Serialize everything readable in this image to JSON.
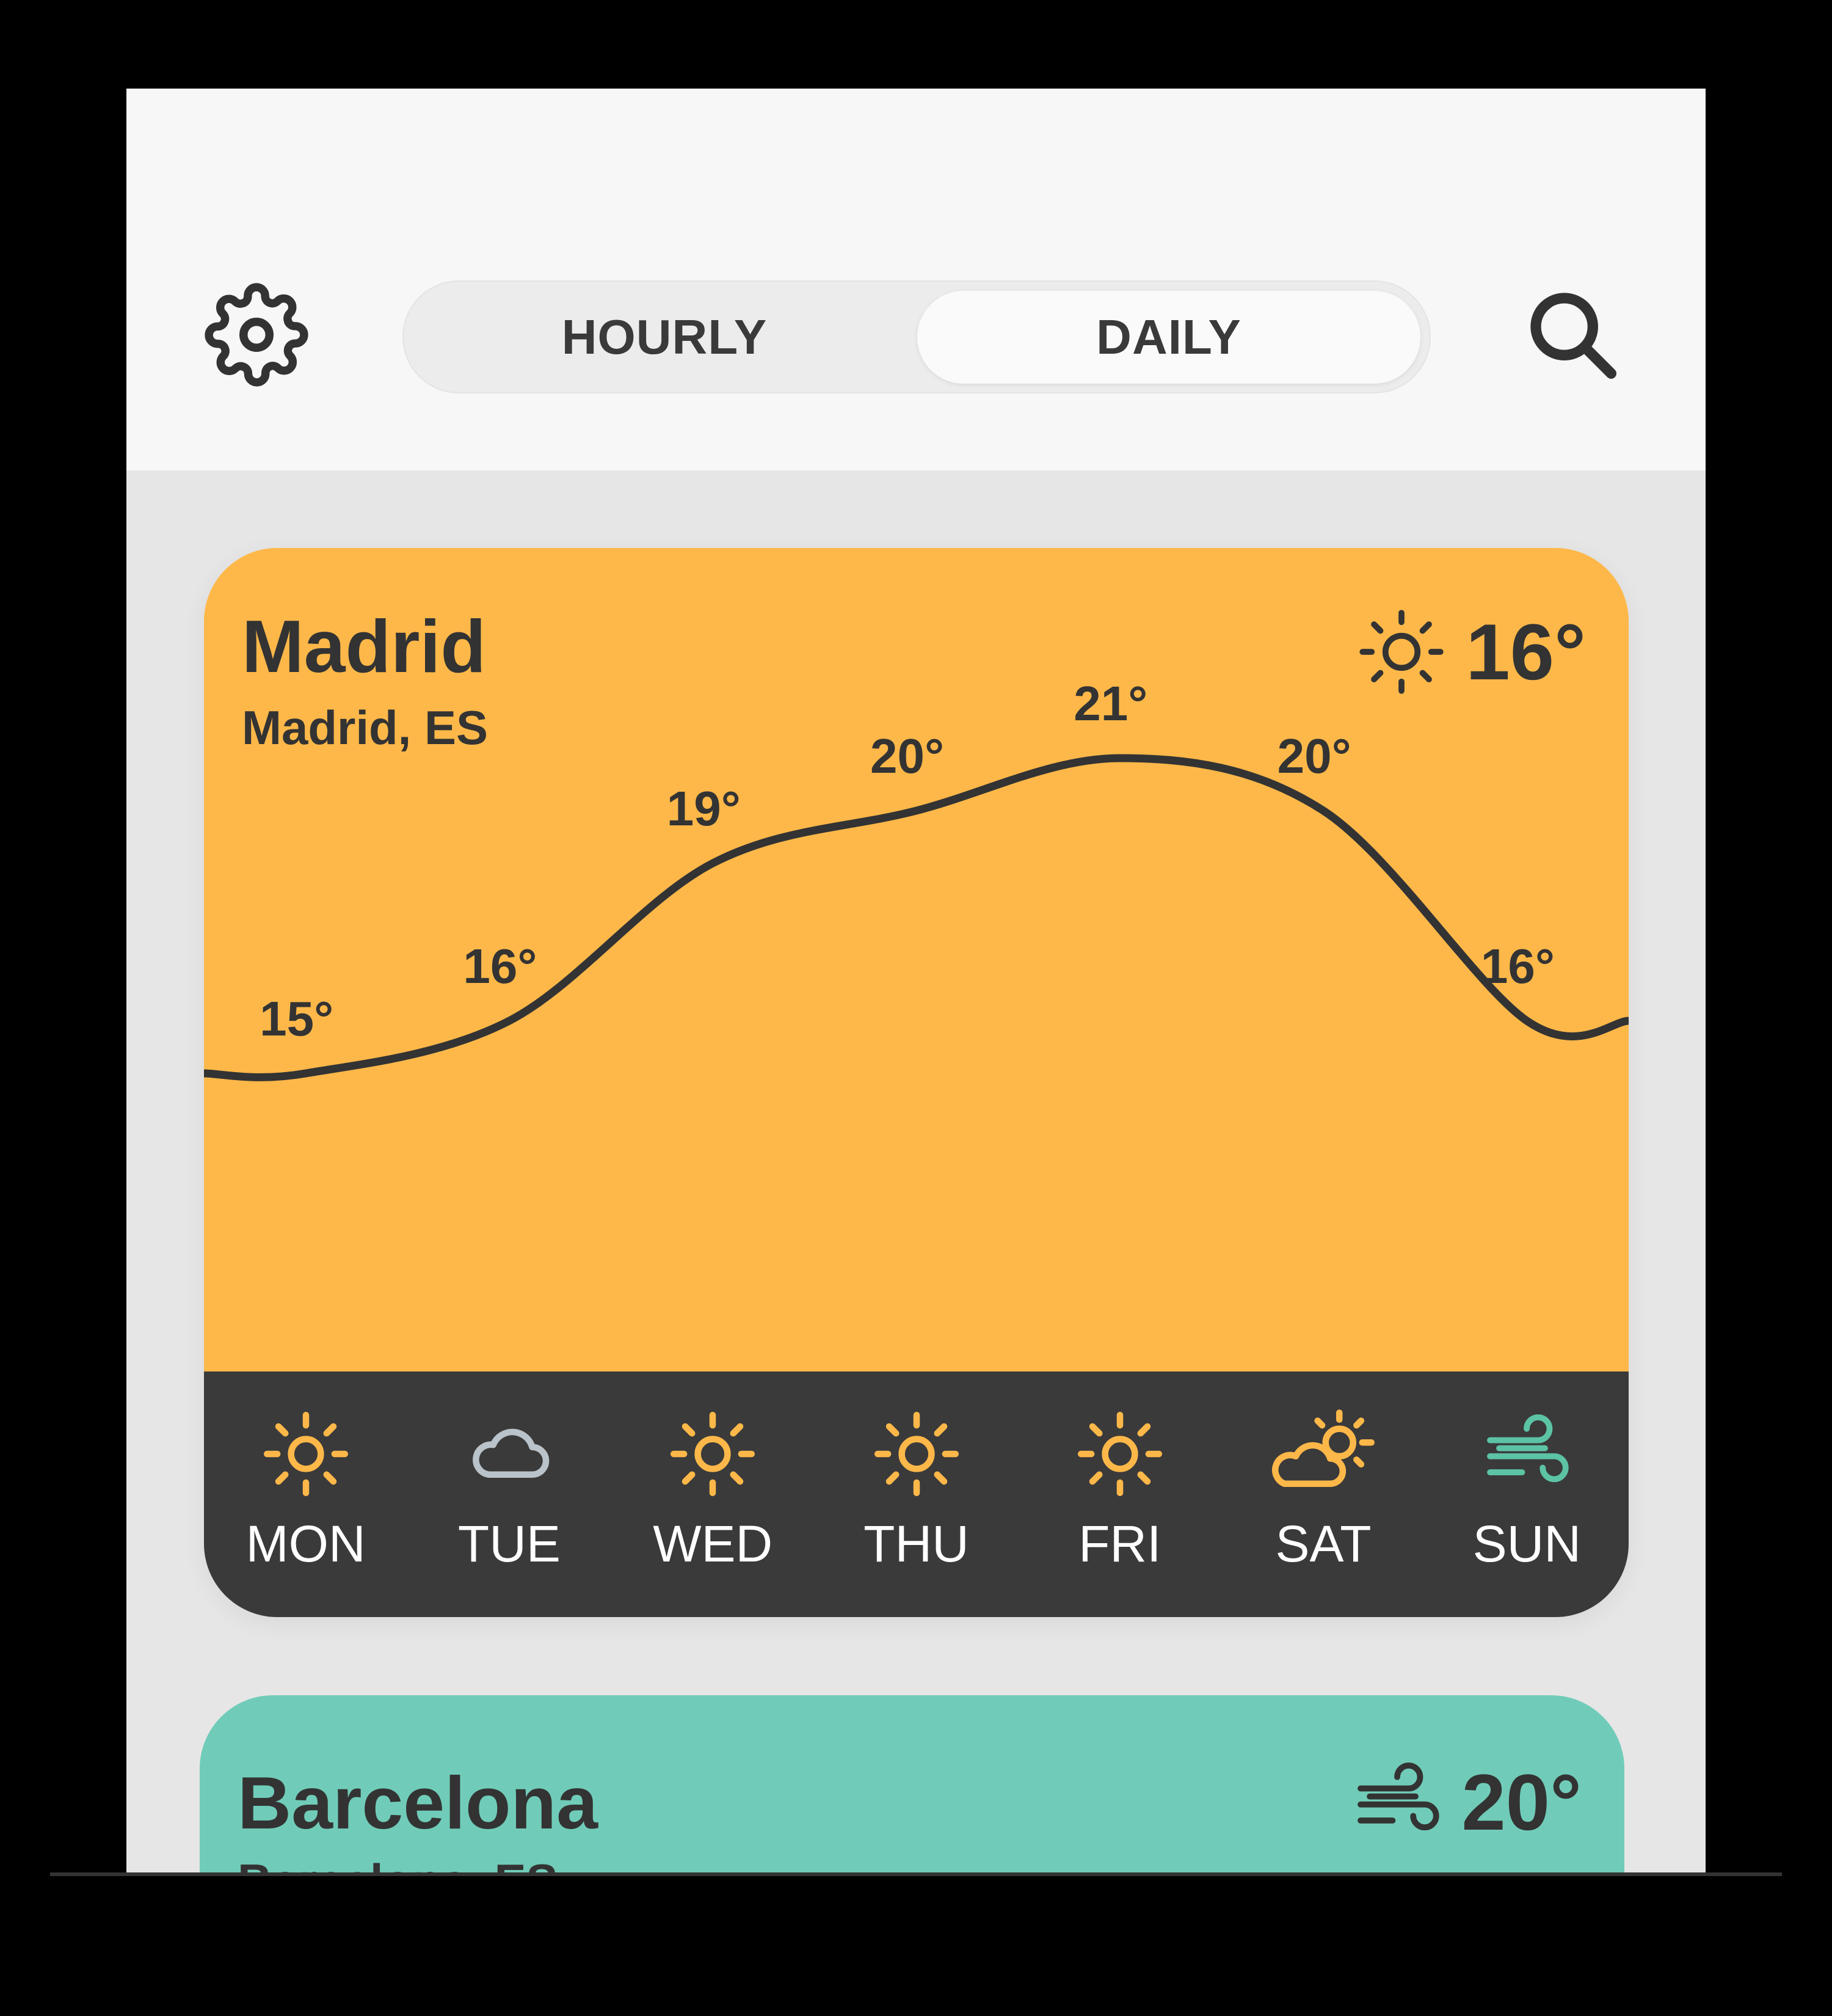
{
  "header": {
    "tabs": [
      {
        "label": "HOURLY",
        "selected": false
      },
      {
        "label": "DAILY",
        "selected": true
      }
    ],
    "settings_icon": "gear-icon",
    "search_icon": "search-icon"
  },
  "cards": [
    {
      "city": "Madrid",
      "region": "Madrid, ES",
      "current_temp": "16°",
      "current_icon": "sun-icon",
      "background": "#fdb849",
      "days": [
        {
          "name": "MON",
          "temp": "15°",
          "icon": "sun-icon"
        },
        {
          "name": "TUE",
          "temp": "16°",
          "icon": "cloud-icon"
        },
        {
          "name": "WED",
          "temp": "19°",
          "icon": "sun-icon"
        },
        {
          "name": "THU",
          "temp": "20°",
          "icon": "sun-icon"
        },
        {
          "name": "FRI",
          "temp": "21°",
          "icon": "sun-icon"
        },
        {
          "name": "SAT",
          "temp": "20°",
          "icon": "partly-cloudy-icon"
        },
        {
          "name": "SUN",
          "temp": "16°",
          "icon": "wind-icon"
        }
      ]
    },
    {
      "city": "Barcelona",
      "region": "Barcelona, ES",
      "current_temp": "20°",
      "current_icon": "wind-icon",
      "background": "#70ccb8"
    }
  ],
  "chart_data": {
    "type": "line",
    "categories": [
      "MON",
      "TUE",
      "WED",
      "THU",
      "FRI",
      "SAT",
      "SUN"
    ],
    "series": [
      {
        "values": [
          15,
          16,
          19,
          20,
          21,
          20,
          16
        ]
      }
    ]
  },
  "colors": {
    "sun": "#fdb849",
    "cloud": "#b9c3c9",
    "wind": "#5cc3a5",
    "text_dark": "#333333",
    "day_bar": "#3a3a3a"
  }
}
